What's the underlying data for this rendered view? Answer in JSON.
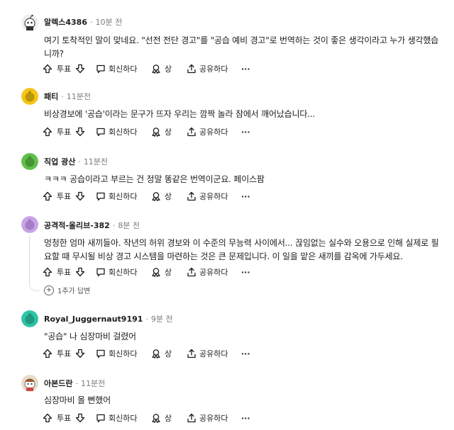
{
  "comments": [
    {
      "user": "알렉스4386",
      "time": "10분 전",
      "text": "여기 토착적인 말이 맞네요. \"선전 전단 경고\"를 \"공습 예비 경고\"로 번역하는 것이 좋은 생각이라고 누가 생각했습니까?",
      "avatar_color": "#d8d8d8"
    },
    {
      "user": "패티",
      "time": "11분전",
      "text": "비상경보에 '공습'이라는 문구가 뜨자 우리는 깜짝 놀라 잠에서 깨어났습니다...",
      "avatar_color": "#f5c518"
    },
    {
      "user": "직업 광산",
      "time": "11분전",
      "text": "ㅋㅋㅋ 공습이라고 부르는 건 정말 똥같은 번역이군요. 페이스팜",
      "avatar_color": "#5fc04a"
    },
    {
      "user": "공격적-올리브-382",
      "time": "8분 전",
      "text": "멍청한 엄마 새끼들아. 작년의 허위 경보와 이 수준의 무능력 사이에서... 끊임없는 실수와 오용으로 인해 실제로 필요할 때 무시될 비상 경고 시스템을 마련하는 것은 큰 문제입니다. 이 일을 맡은 새끼를 감옥에 가두세요.",
      "avatar_color": "#c9a3e8",
      "more_replies": "1추가 답변"
    },
    {
      "user": "Royal_Juggernaut9191",
      "time": "9분 전",
      "text": "\"공습\" 나 심장마비 걸렸어",
      "avatar_color": "#2ec4a6"
    },
    {
      "user": "아본드란",
      "time": "11분전",
      "text": "심장마비 올 뻔했어",
      "avatar_color": "#e8dcc8"
    }
  ],
  "actions": {
    "vote": "투표",
    "reply": "회신하다",
    "award": "상",
    "share": "공유하다",
    "more": "···"
  },
  "icons": {
    "upvote": "arrow-up-icon",
    "downvote": "arrow-down-icon",
    "reply": "comment-bubble-icon",
    "award": "award-icon",
    "share": "share-icon",
    "more": "ellipsis-icon"
  },
  "colors": {
    "text": "#1c1c1c",
    "meta": "#7c7c7c",
    "thread": "#dcdcdc"
  }
}
